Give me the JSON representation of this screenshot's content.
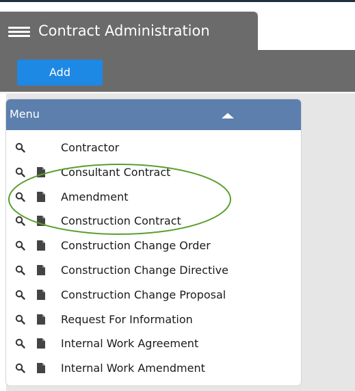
{
  "app": {
    "title": "Contract Administration",
    "menu_icon": "hamburger-icon"
  },
  "toolbar": {
    "add_label": "Add",
    "add_color": "#1e88e5"
  },
  "menu": {
    "title": "Menu",
    "collapse_icon": "caret-up-icon",
    "header_color": "#5d7fae",
    "items": [
      {
        "label": "Contractor",
        "icons": [
          "search-icon"
        ]
      },
      {
        "label": "Consultant Contract",
        "icons": [
          "search-icon",
          "document-icon"
        ]
      },
      {
        "label": "Amendment",
        "icons": [
          "search-icon",
          "document-icon"
        ]
      },
      {
        "label": "Construction Contract",
        "icons": [
          "search-icon",
          "document-icon"
        ]
      },
      {
        "label": "Construction Change Order",
        "icons": [
          "search-icon",
          "document-icon"
        ]
      },
      {
        "label": "Construction Change Directive",
        "icons": [
          "search-icon",
          "document-icon"
        ]
      },
      {
        "label": "Construction Change Proposal",
        "icons": [
          "search-icon",
          "document-icon"
        ]
      },
      {
        "label": "Request For Information",
        "icons": [
          "search-icon",
          "document-icon"
        ]
      },
      {
        "label": "Internal Work Agreement",
        "icons": [
          "search-icon",
          "document-icon"
        ]
      },
      {
        "label": "Internal Work Amendment",
        "icons": [
          "search-icon",
          "document-icon"
        ]
      }
    ]
  },
  "annotation": {
    "shape": "ellipse",
    "color": "#5a9e2f",
    "highlighted_items": [
      "Consultant Contract",
      "Amendment",
      "Construction Contract"
    ]
  }
}
